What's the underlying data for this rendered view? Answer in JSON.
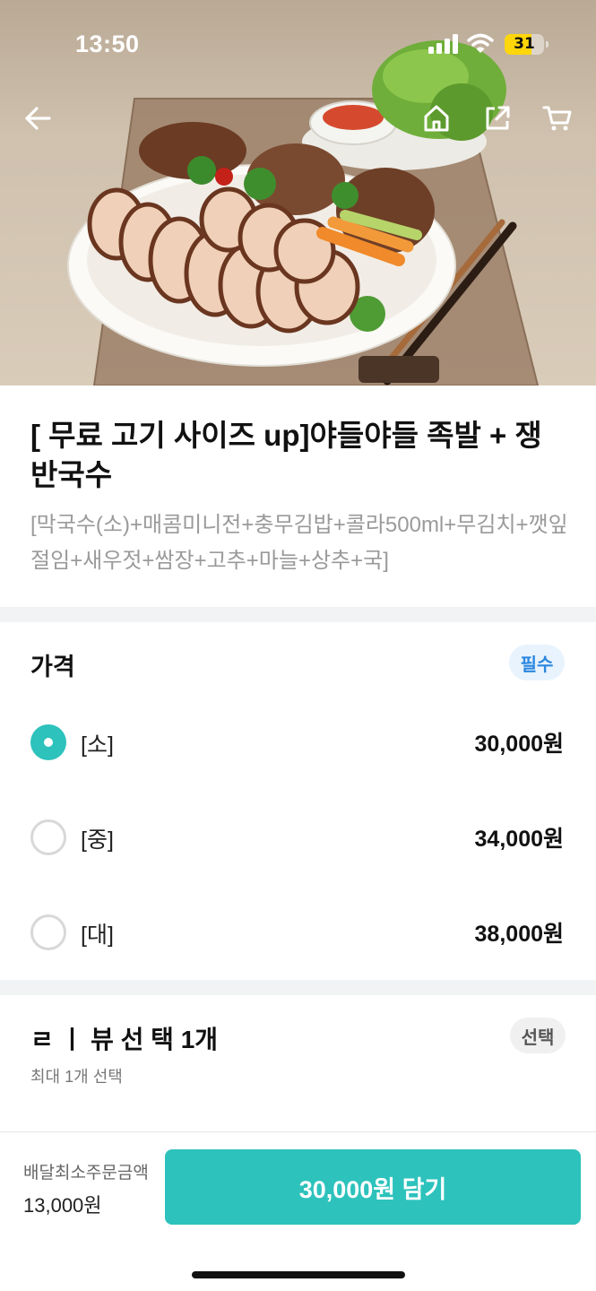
{
  "status_bar": {
    "time": "13:50",
    "battery": "31"
  },
  "nav": {
    "back": "back-arrow-icon",
    "home": "home-icon",
    "share": "share-icon",
    "cart": "cart-icon"
  },
  "product": {
    "title": "[ 무료 고기 사이즈 up]야들야들 족발 + 쟁반국수",
    "description": "[막국수(소)+매콤미니전+충무김밥+콜라500ml+무김치+깻잎절임+새우젓+쌈장+고추+마늘+상추+국]"
  },
  "price_section": {
    "heading": "가격",
    "badge": "필수",
    "options": [
      {
        "label": "[소]",
        "price": "30,000원",
        "selected": true
      },
      {
        "label": "[중]",
        "price": "34,000원",
        "selected": false
      },
      {
        "label": "[대]",
        "price": "38,000원",
        "selected": false
      }
    ]
  },
  "choice_section": {
    "heading": "ㄹ ㅣ 뷰 선 택 1개",
    "badge": "선택",
    "note": "최대 1개 선택"
  },
  "bottom_bar": {
    "min_order_label": "배달최소주문금액",
    "min_order_value": "13,000원",
    "add_button": "30,000원 담기"
  },
  "colors": {
    "accent": "#2dc2bc",
    "required_badge": "#2b87e0"
  }
}
